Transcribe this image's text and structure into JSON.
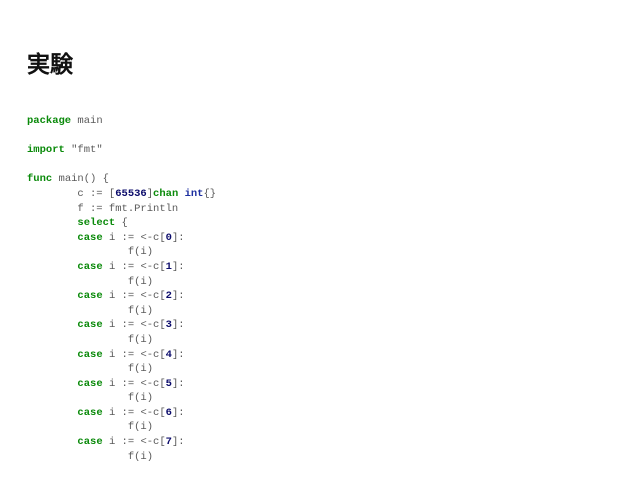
{
  "slide": {
    "title": "実験"
  },
  "code": {
    "lines": [
      [
        {
          "k": "kw",
          "t": "package"
        },
        {
          "k": "plain",
          "t": " main"
        }
      ],
      [],
      [
        {
          "k": "kw",
          "t": "import"
        },
        {
          "k": "plain",
          "t": " "
        },
        {
          "k": "str",
          "t": "\"fmt\""
        }
      ],
      [],
      [
        {
          "k": "kw",
          "t": "func"
        },
        {
          "k": "plain",
          "t": " main() {"
        }
      ],
      [
        {
          "k": "plain",
          "t": "        c := ["
        },
        {
          "k": "num",
          "t": "65536"
        },
        {
          "k": "plain",
          "t": "]"
        },
        {
          "k": "kw",
          "t": "chan"
        },
        {
          "k": "plain",
          "t": " "
        },
        {
          "k": "type",
          "t": "int"
        },
        {
          "k": "plain",
          "t": "{}"
        }
      ],
      [
        {
          "k": "plain",
          "t": "        f := fmt.Println"
        }
      ],
      [
        {
          "k": "plain",
          "t": "        "
        },
        {
          "k": "kw",
          "t": "select"
        },
        {
          "k": "plain",
          "t": " {"
        }
      ],
      [
        {
          "k": "plain",
          "t": "        "
        },
        {
          "k": "kw",
          "t": "case"
        },
        {
          "k": "plain",
          "t": " i := <-c["
        },
        {
          "k": "num",
          "t": "0"
        },
        {
          "k": "plain",
          "t": "]:"
        }
      ],
      [
        {
          "k": "plain",
          "t": "                f(i)"
        }
      ],
      [
        {
          "k": "plain",
          "t": "        "
        },
        {
          "k": "kw",
          "t": "case"
        },
        {
          "k": "plain",
          "t": " i := <-c["
        },
        {
          "k": "num",
          "t": "1"
        },
        {
          "k": "plain",
          "t": "]:"
        }
      ],
      [
        {
          "k": "plain",
          "t": "                f(i)"
        }
      ],
      [
        {
          "k": "plain",
          "t": "        "
        },
        {
          "k": "kw",
          "t": "case"
        },
        {
          "k": "plain",
          "t": " i := <-c["
        },
        {
          "k": "num",
          "t": "2"
        },
        {
          "k": "plain",
          "t": "]:"
        }
      ],
      [
        {
          "k": "plain",
          "t": "                f(i)"
        }
      ],
      [
        {
          "k": "plain",
          "t": "        "
        },
        {
          "k": "kw",
          "t": "case"
        },
        {
          "k": "plain",
          "t": " i := <-c["
        },
        {
          "k": "num",
          "t": "3"
        },
        {
          "k": "plain",
          "t": "]:"
        }
      ],
      [
        {
          "k": "plain",
          "t": "                f(i)"
        }
      ],
      [
        {
          "k": "plain",
          "t": "        "
        },
        {
          "k": "kw",
          "t": "case"
        },
        {
          "k": "plain",
          "t": " i := <-c["
        },
        {
          "k": "num",
          "t": "4"
        },
        {
          "k": "plain",
          "t": "]:"
        }
      ],
      [
        {
          "k": "plain",
          "t": "                f(i)"
        }
      ],
      [
        {
          "k": "plain",
          "t": "        "
        },
        {
          "k": "kw",
          "t": "case"
        },
        {
          "k": "plain",
          "t": " i := <-c["
        },
        {
          "k": "num",
          "t": "5"
        },
        {
          "k": "plain",
          "t": "]:"
        }
      ],
      [
        {
          "k": "plain",
          "t": "                f(i)"
        }
      ],
      [
        {
          "k": "plain",
          "t": "        "
        },
        {
          "k": "kw",
          "t": "case"
        },
        {
          "k": "plain",
          "t": " i := <-c["
        },
        {
          "k": "num",
          "t": "6"
        },
        {
          "k": "plain",
          "t": "]:"
        }
      ],
      [
        {
          "k": "plain",
          "t": "                f(i)"
        }
      ],
      [
        {
          "k": "plain",
          "t": "        "
        },
        {
          "k": "kw",
          "t": "case"
        },
        {
          "k": "plain",
          "t": " i := <-c["
        },
        {
          "k": "num",
          "t": "7"
        },
        {
          "k": "plain",
          "t": "]:"
        }
      ],
      [
        {
          "k": "plain",
          "t": "                f(i)"
        }
      ]
    ]
  },
  "colors": {
    "background": "#ffffff",
    "title": "#111111",
    "keyword": "#0a8a0a",
    "number": "#0b0b6b",
    "type": "#1d2fa0",
    "plain": "#5a5a5a"
  }
}
